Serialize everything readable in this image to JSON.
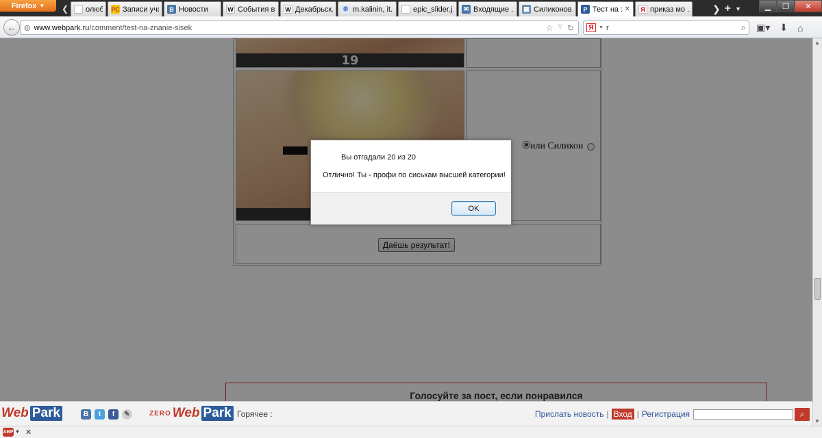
{
  "browser": {
    "menu_button": "Firefox",
    "tabs": [
      {
        "title": "олюби...",
        "icon": "page-icon",
        "active": false
      },
      {
        "title": "Записи уча...",
        "icon": "rs-icon",
        "active": false
      },
      {
        "title": "Новости",
        "icon": "vk-icon",
        "active": false
      },
      {
        "title": "События в ...",
        "icon": "wikipedia-icon",
        "active": false
      },
      {
        "title": "Декабрьск...",
        "icon": "wikipedia-icon",
        "active": false
      },
      {
        "title": "m.kalinin, it...",
        "icon": "network-icon",
        "active": false
      },
      {
        "title": "epic_slider.j...",
        "icon": "blank-page-icon",
        "active": false
      },
      {
        "title": "Входящие ...",
        "icon": "mail-icon",
        "active": false
      },
      {
        "title": "Силиконов...",
        "icon": "image-icon",
        "active": false
      },
      {
        "title": "Тест на з...",
        "icon": "webpark-icon",
        "active": true
      },
      {
        "title": "приказ мо ...",
        "icon": "yandex-icon",
        "active": false
      }
    ],
    "url": {
      "host": "www.webpark.ru",
      "path": "/comment/test-na-znanie-sisek"
    },
    "search": {
      "engine_logo": "Я",
      "value": "r"
    }
  },
  "quiz": {
    "photo_number": "19",
    "option_a_label": "",
    "option_b_label": "или Силикон",
    "result_button": "Даёшь результат!"
  },
  "vote_banner": "Голосуйте за пост, если понравился",
  "bottom_bar": {
    "logo_web": "Web",
    "logo_park": "Park",
    "zero_prefix": "ZERO",
    "hot_label": "Горячее :",
    "send_news": "Прислать новость",
    "separator": "|",
    "login": "Вход",
    "register": "Регистрация"
  },
  "dialog": {
    "line1": "Вы отгадали 20 из 20",
    "line2": "Отлично! Ты - профи по сиськам высшей категории!",
    "ok_label": "OK"
  },
  "colors": {
    "brand_red": "#c0392b",
    "brand_blue": "#2c5b9a",
    "firefox_orange": "#e2701a"
  }
}
